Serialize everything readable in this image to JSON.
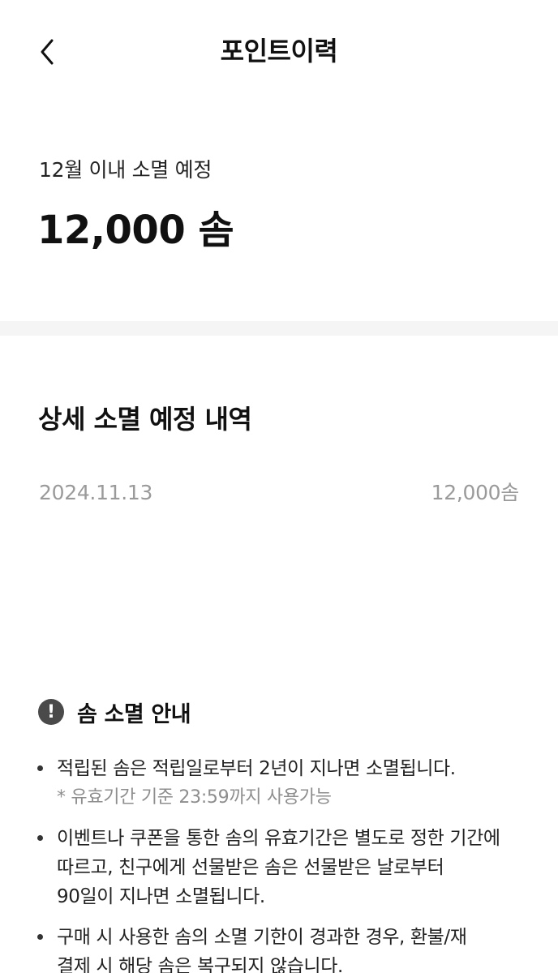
{
  "header": {
    "title": "포인트이력",
    "back_icon": "chevron-left-icon"
  },
  "summary": {
    "label": "12월 이내 소멸 예정",
    "amount": "12,000 솜"
  },
  "detail": {
    "title": "상세 소멸 예정 내역",
    "rows": [
      {
        "date": "2024.11.13",
        "amount": "12,000솜"
      }
    ]
  },
  "notice": {
    "icon_glyph": "!",
    "title": "솜 소멸 안내",
    "items": [
      {
        "lines": [
          "적립된 솜은 적립일로부터 2년이 지나면 소멸됩니다."
        ],
        "sub": "* 유효기간 기준 23:59까지 사용가능"
      },
      {
        "lines": [
          "이벤트나 쿠폰을 통한 솜의 유효기간은 별도로 정한 기간에",
          "따르고, 친구에게 선물받은 솜은 선물받은 날로부터",
          "90일이 지나면 소멸됩니다."
        ]
      },
      {
        "lines": [
          "구매 시 사용한 솜의 소멸 기한이 경과한 경우, 환불/재",
          "결제 시 해당 솜은 복구되지 않습니다."
        ]
      }
    ]
  },
  "colors": {
    "text_primary": "#111111",
    "text_muted": "#9a9a9a",
    "divider": "#f5f5f5",
    "alert_icon_bg": "#4a4a4a"
  }
}
